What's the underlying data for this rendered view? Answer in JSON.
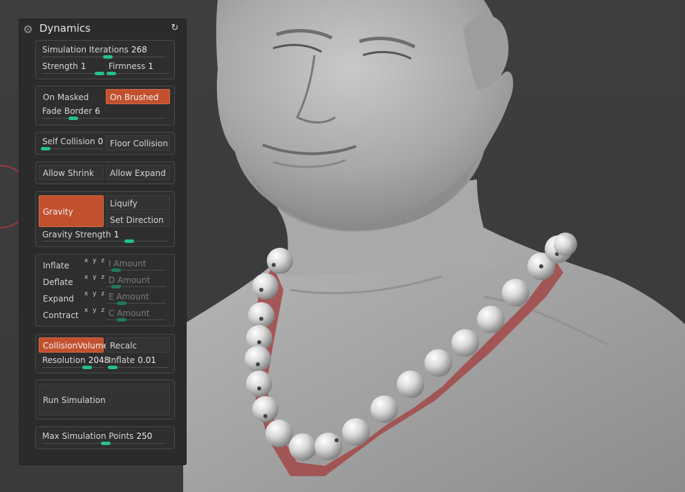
{
  "panel": {
    "title": "Dynamics",
    "icons": {
      "header": "gear-icon",
      "reset": "refresh-icon"
    },
    "accent": "#c2502e",
    "slider_color": "#26c08a"
  },
  "simulation": {
    "iterations_label": "Simulation Iterations",
    "iterations_value": "268",
    "strength_label": "Strength",
    "strength_value": "1",
    "firmness_label": "Firmness",
    "firmness_value": "1"
  },
  "masking": {
    "on_masked": "On Masked",
    "on_brushed": "On Brushed",
    "fade_border_label": "Fade Border",
    "fade_border_value": "6"
  },
  "collision": {
    "self_collision_label": "Self Collision",
    "self_collision_value": "0",
    "floor_collision": "Floor Collision"
  },
  "shrink": {
    "allow_shrink": "Allow Shrink",
    "allow_expand": "Allow Expand"
  },
  "gravity": {
    "gravity": "Gravity",
    "liquify": "Liquify",
    "set_direction": "Set Direction",
    "strength_label": "Gravity Strength",
    "strength_value": "1"
  },
  "deform": {
    "xyz": "x y z",
    "inflate": "Inflate",
    "i_amount": "I Amount",
    "deflate": "Deflate",
    "d_amount": "D Amount",
    "expand": "Expand",
    "e_amount": "E Amount",
    "contract": "Contract",
    "c_amount": "C Amount"
  },
  "volume": {
    "collision_volume": "CollisionVolume",
    "recalc": "Recalc",
    "resolution_label": "Resolution",
    "resolution_value": "2048",
    "inflate_label": "Inflate",
    "inflate_value": "0.01"
  },
  "run": {
    "run_simulation": "Run Simulation"
  },
  "max_points": {
    "label": "Max Simulation Points",
    "value": "250"
  }
}
